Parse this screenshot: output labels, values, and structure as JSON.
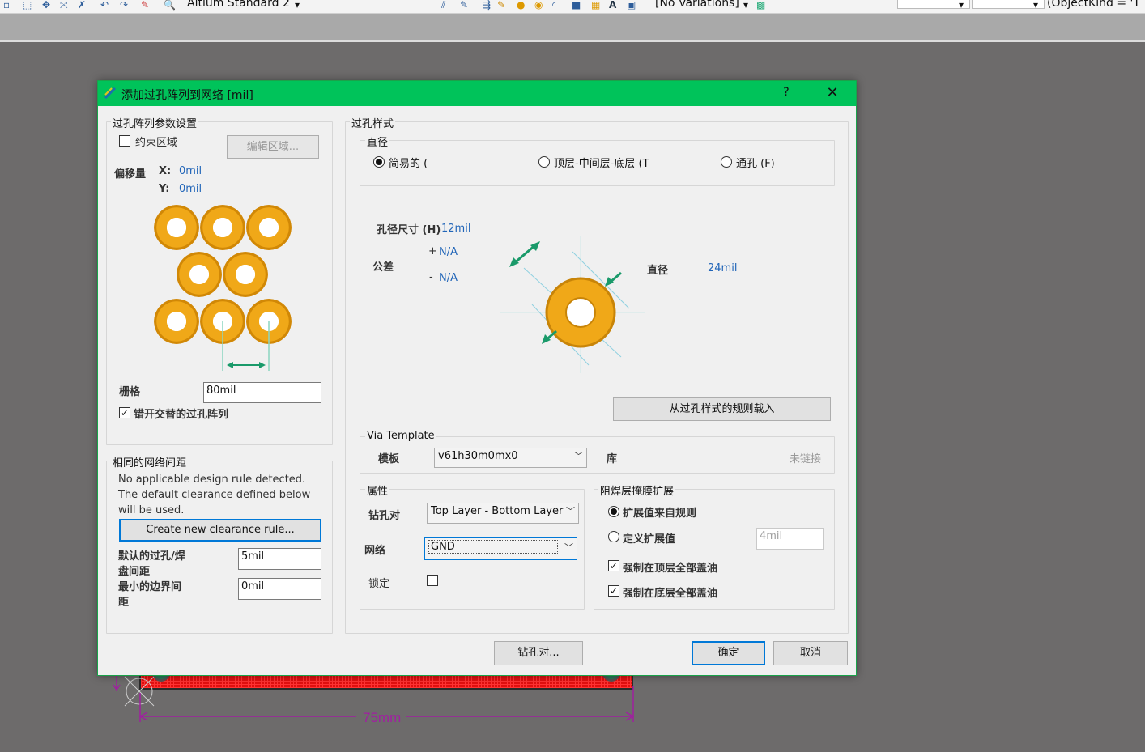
{
  "toolbar": {
    "standard_label": "Altium Standard 2",
    "variations_label": "[No Variations]",
    "filter_label": "(ObjectKind = 'T"
  },
  "dialog": {
    "title": "添加过孔阵列到网络 [mil]",
    "help_label": "?",
    "close_label": "✕",
    "array_group": {
      "legend": "过孔阵列参数设置",
      "constrain_label": "约束区域",
      "constrain_checked": false,
      "edit_area_label": "编辑区域...",
      "offset_label": "偏移量",
      "x_label": "X:",
      "x_value": "0mil",
      "y_label": "Y:",
      "y_value": "0mil",
      "grid_label": "栅格",
      "grid_value": "80mil",
      "stagger_label": "错开交替的过孔阵列",
      "stagger_checked": true
    },
    "clearance_group": {
      "legend": "相同的网络间距",
      "message_line1": "No applicable design rule detected.",
      "message_line2": "The default clearance defined below",
      "message_line3": "will be used.",
      "create_rule_label": "Create new clearance rule...",
      "default_label_1": "默认的过孔/焊",
      "default_label_2": "盘间距",
      "default_value": "5mil",
      "min_label_1": "最小的边界间",
      "min_label_2": "距",
      "min_value": "0mil"
    },
    "via_style": {
      "legend": "过孔样式",
      "diameter_legend": "直径",
      "radio_simple": "简易的 (",
      "radio_top_mid_bottom": "顶层-中间层-底层 (T",
      "radio_full_stack": "通孔 (F)",
      "selected": "simple",
      "hole_size_label": "孔径尺寸 (H)",
      "hole_size_value": "12mil",
      "tolerance_label": "公差",
      "tol_plus_sign": "+",
      "tol_plus_value": "N/A",
      "tol_minus_sign": "-",
      "tol_minus_value": "N/A",
      "diameter_label": "直径",
      "diameter_value": "24mil",
      "load_rule_label": "从过孔样式的规则载入"
    },
    "via_template": {
      "legend": "Via Template",
      "template_label": "模板",
      "template_value": "v61h30m0mx0",
      "library_label": "库",
      "library_value": "未链接"
    },
    "properties": {
      "legend": "属性",
      "drill_pair_label": "钻孔对",
      "drill_pair_value": "Top Layer - Bottom Layer",
      "net_label": "网络",
      "net_value": "GND",
      "lock_label": "锁定",
      "lock_checked": false
    },
    "solder_mask": {
      "legend": "阻焊层掩膜扩展",
      "from_rule_label": "扩展值来自规则",
      "manual_label": "定义扩展值",
      "selected": "from_rule",
      "manual_value": "4mil",
      "force_top_label": "强制在顶层全部盖油",
      "force_top_checked": true,
      "force_bottom_label": "强制在底层全部盖油",
      "force_bottom_checked": true
    },
    "footer": {
      "drill_pairs_label": "钻孔对...",
      "ok_label": "确定",
      "cancel_label": "取消"
    }
  },
  "pcb": {
    "dimension_label": "75mm"
  },
  "colors": {
    "title_bar": "#00c35a",
    "via_ring": "#f0a818",
    "value_text": "#2165b8",
    "pcb_red": "#e01010",
    "dimension": "#a020a0"
  }
}
